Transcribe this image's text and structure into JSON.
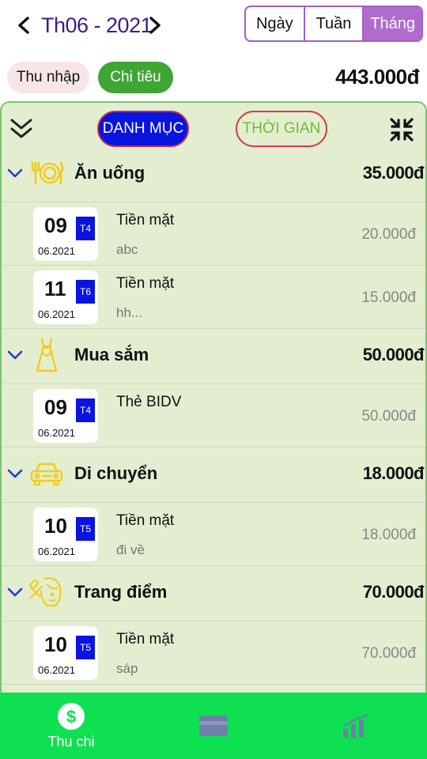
{
  "header": {
    "month_label": "Th06 - 2021",
    "segments": [
      "Ngày",
      "Tuần",
      "Tháng"
    ],
    "active_segment": "Tháng"
  },
  "type_toggle": {
    "income_label": "Thu nhập",
    "expense_label": "Chi tiêu",
    "total": "443.000đ"
  },
  "toolbar": {
    "category_label": "DANH MỤC",
    "time_label": "THỜI GIAN"
  },
  "categories": [
    {
      "name": "Ăn uống",
      "icon": "dining-icon",
      "amount": "35.000đ",
      "transactions": [
        {
          "day": "09",
          "dow": "T4",
          "month_year": "06.2021",
          "method": "Tiền mặt",
          "note": "abc",
          "amount": "20.000đ"
        },
        {
          "day": "11",
          "dow": "T6",
          "month_year": "06.2021",
          "method": "Tiền mặt",
          "note": "hh...",
          "amount": "15.000đ"
        }
      ]
    },
    {
      "name": "Mua sắm",
      "icon": "dress-icon",
      "amount": "50.000đ",
      "transactions": [
        {
          "day": "09",
          "dow": "T4",
          "month_year": "06.2021",
          "method": "Thẻ BIDV",
          "note": "",
          "amount": "50.000đ"
        }
      ]
    },
    {
      "name": "Di chuyển",
      "icon": "car-icon",
      "amount": "18.000đ",
      "transactions": [
        {
          "day": "10",
          "dow": "T5",
          "month_year": "06.2021",
          "method": "Tiền mặt",
          "note": "đi về",
          "amount": "18.000đ"
        }
      ]
    },
    {
      "name": "Trang điểm",
      "icon": "makeup-icon",
      "amount": "70.000đ",
      "transactions": [
        {
          "day": "10",
          "dow": "T5",
          "month_year": "06.2021",
          "method": "Tiền mặt",
          "note": "sáp",
          "amount": "70.000đ"
        }
      ]
    }
  ],
  "bottom_nav": {
    "items": [
      {
        "label": "Thu chi",
        "icon": "dollar-icon",
        "active": true
      },
      {
        "label": "",
        "icon": "card-icon",
        "active": false
      },
      {
        "label": "",
        "icon": "chart-icon",
        "active": false
      }
    ]
  },
  "colors": {
    "accent_purple": "#b06ccc",
    "expense_green": "#3fa535",
    "panel_bg": "#e3edd0",
    "nav_green": "#0ee052",
    "dow_blue": "#0a14e0",
    "icon_yellow": "#f2cc1a"
  }
}
